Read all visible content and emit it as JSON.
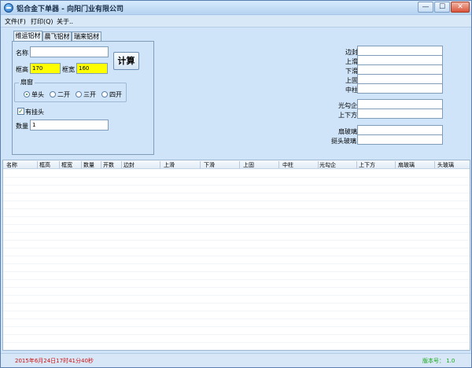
{
  "window": {
    "title": "铝合金下单器 - 向阳门业有限公司",
    "controls": {
      "minimize": "—",
      "maximize": "☐",
      "close": "✕"
    }
  },
  "menu": [
    {
      "label": "文件(F)"
    },
    {
      "label": "打印(Q)"
    },
    {
      "label": "关于.."
    }
  ],
  "tabs": [
    {
      "label": "维运铝材",
      "active": true
    },
    {
      "label": "晨飞铝材",
      "active": false
    },
    {
      "label": "瑞来铝材",
      "active": false
    }
  ],
  "form": {
    "name_label": "名称",
    "name_value": "",
    "frame_height_label": "框高",
    "frame_height_value": "170",
    "frame_width_label": "框宽",
    "frame_width_value": "160",
    "calc_button": "计算",
    "sash_group_label": "扇窗",
    "sash_options": [
      {
        "label": "单头",
        "checked": true
      },
      {
        "label": "二开",
        "checked": false
      },
      {
        "label": "三开",
        "checked": false
      },
      {
        "label": "四开",
        "checked": false
      }
    ],
    "hook_checkbox_label": "有挂头",
    "hook_checked": true,
    "quantity_label": "数量",
    "quantity_value": "1"
  },
  "results": [
    {
      "label": "边封",
      "value": ""
    },
    {
      "label": "上滑",
      "value": ""
    },
    {
      "label": "下滑",
      "value": ""
    },
    {
      "label": "上固",
      "value": ""
    },
    {
      "label": "中柱",
      "value": ""
    },
    {
      "label": "光勾企",
      "value": ""
    },
    {
      "label": "上下方",
      "value": ""
    },
    {
      "label": "扇玻璃",
      "value": ""
    },
    {
      "label": "挺头玻璃",
      "value": ""
    }
  ],
  "table": {
    "columns": [
      "名称",
      "框高",
      "框宽",
      "数量",
      "开数",
      "边封",
      "上滑",
      "下滑",
      "上固",
      "中柱",
      "光勾企",
      "上下方",
      "扇玻璃",
      "头玻璃"
    ],
    "rows": []
  },
  "status": {
    "datetime": "2015年6月24日17时41分40秒",
    "version": "版本号：  1.0"
  },
  "colors": {
    "highlight_field": "#ffff00",
    "status_time": "#d01010",
    "status_version": "#18a818"
  }
}
